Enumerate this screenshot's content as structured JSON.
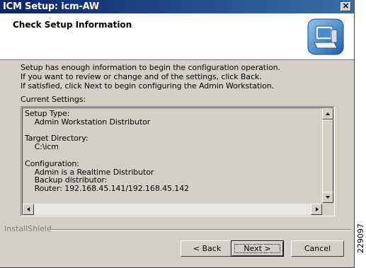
{
  "window": {
    "title": "ICM Setup: icm-AW",
    "close_glyph": "✕"
  },
  "header": {
    "title": "Check Setup Information",
    "icon": "computer-setup-icon"
  },
  "intro_lines": [
    "Setup has enough information to begin the configuration operation.",
    "If you want to review or change and of the settings, click Back.",
    "If satisfied, click Next to begin configuring the Admin Workstation."
  ],
  "current_settings_label": "Current Settings:",
  "settings_text": "Setup Type:\n    Admin Workstation Distributor\n\nTarget Directory:\n    C:\\icm\n\nConfiguration:\n    Admin is a Realtime Distributor\n    Backup distributor:\n    Router: 192.168.45.141/192.168.45.142",
  "footer": {
    "brand": "InstallShield"
  },
  "buttons": {
    "back": "< Back",
    "next": "Next >",
    "cancel": "Cancel"
  },
  "figure_id": "229097"
}
